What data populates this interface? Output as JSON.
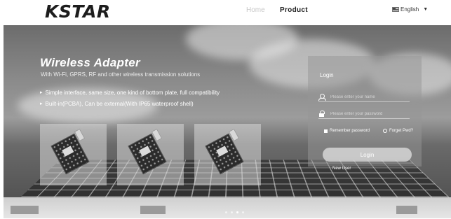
{
  "header": {
    "logo": "KSTAR",
    "nav": [
      {
        "label": "Home"
      },
      {
        "label": "Product"
      }
    ],
    "language": {
      "label": "English",
      "flag_icon": "us-flag-icon"
    }
  },
  "hero": {
    "title": "Wireless Adapter",
    "subtitle": "With Wi-Fi, GPRS, RF and other wireless transmission solutions",
    "features": [
      "Simple interface, same size, one kind of bottom plate, full compatibility",
      "Built-in(PCBA), Can be external(With IP65 waterproof shell)"
    ],
    "products": [
      {
        "icon": "wifi-adapter-board-icon"
      },
      {
        "icon": "gprs-adapter-board-icon"
      },
      {
        "icon": "rf-adapter-board-icon"
      }
    ],
    "carousel": {
      "slides": 4,
      "active": 2
    }
  },
  "login": {
    "title": "Login",
    "username_placeholder": "Please enter your name",
    "password_placeholder": "Please enter your password",
    "remember_label": "Remember password",
    "forgot_label": "Forget Pwd?",
    "button_label": "Login",
    "new_user_label": "New User"
  },
  "colors": {
    "header_bg": "#ffffff",
    "logo": "#1d1d1d",
    "overlay": "#969696"
  }
}
